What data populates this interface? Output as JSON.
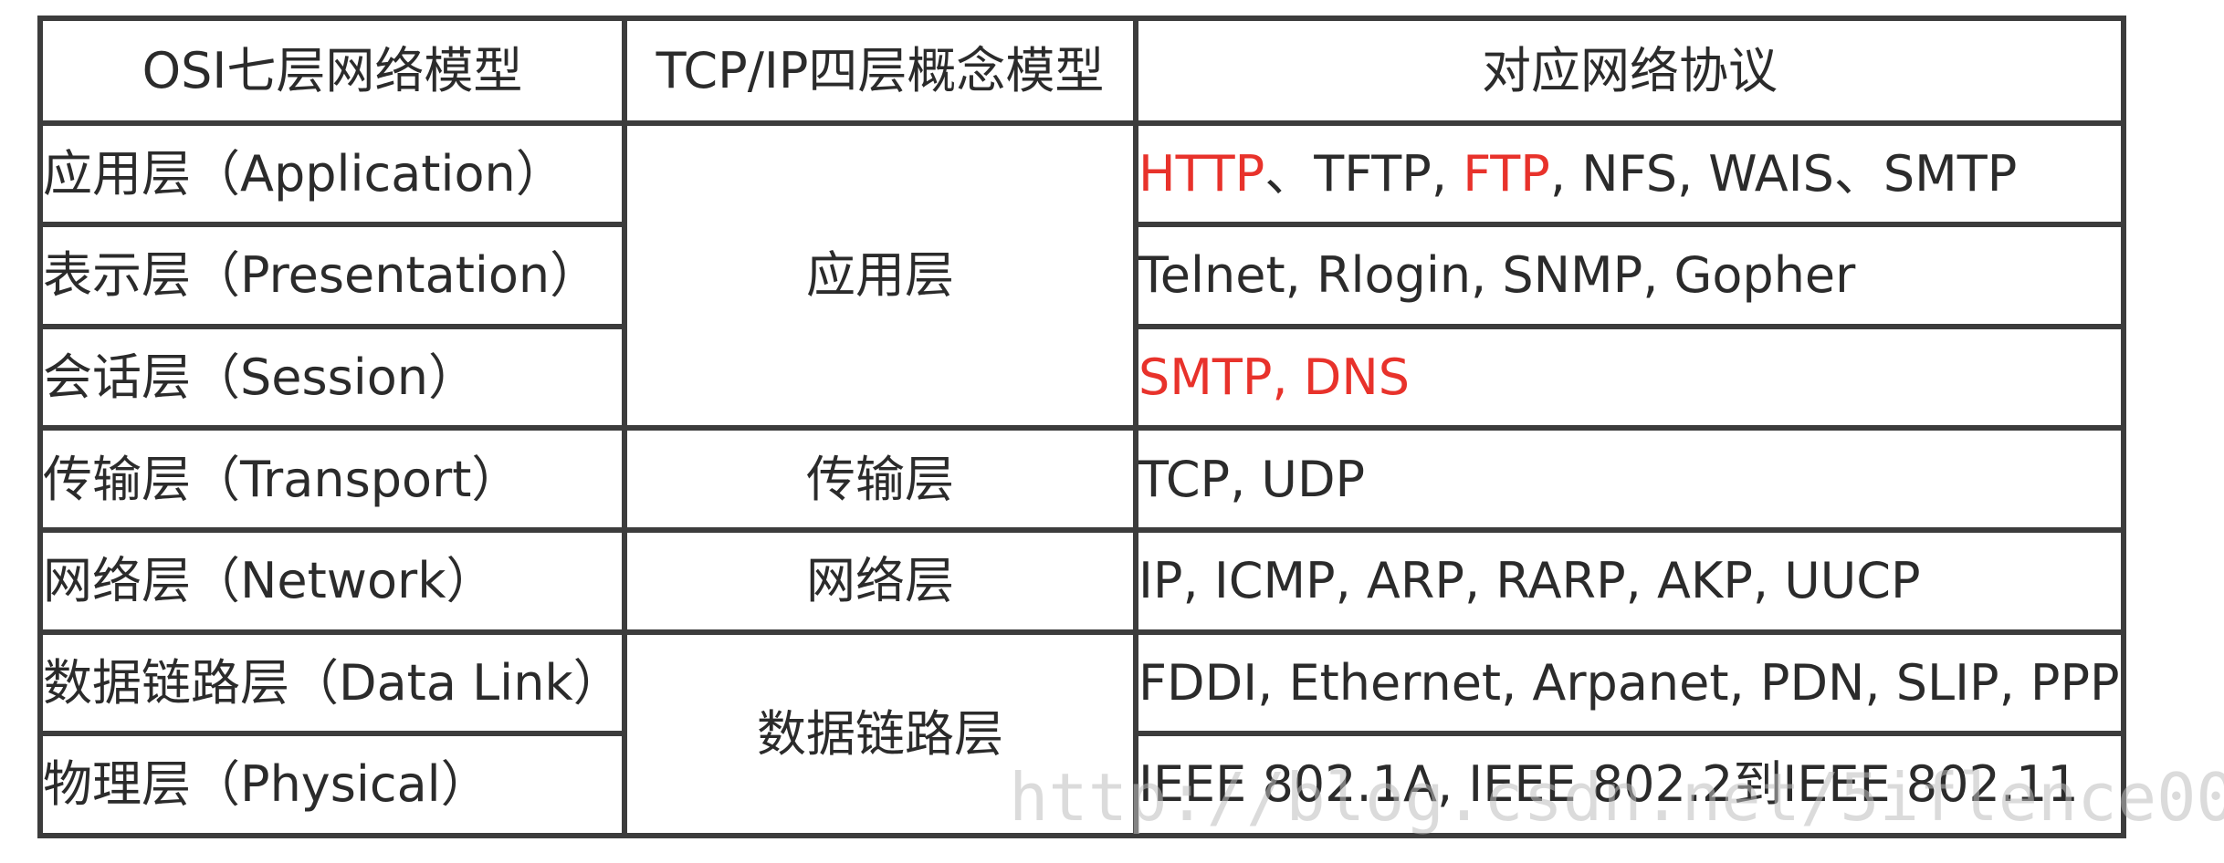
{
  "header": {
    "osi_model": "OSI七层网络模型",
    "tcpip_model": "TCP/IP四层概念模型",
    "protocols": "对应网络协议"
  },
  "rows": [
    {
      "osi": "应用层（Application）",
      "tcpip": "应用层",
      "protocols": [
        {
          "text": "HTTP",
          "red": true
        },
        {
          "text": "、TFTP, ",
          "red": false
        },
        {
          "text": "FTP",
          "red": true
        },
        {
          "text": ", NFS, WAIS、SMTP",
          "red": false
        }
      ]
    },
    {
      "osi": "表示层（Presentation）",
      "protocols": [
        {
          "text": "Telnet, Rlogin, SNMP, Gopher",
          "red": false
        }
      ]
    },
    {
      "osi": "会话层（Session）",
      "protocols": [
        {
          "text": "SMTP, DNS",
          "red": true
        }
      ]
    },
    {
      "osi": "传输层（Transport）",
      "tcpip": "传输层",
      "protocols": [
        {
          "text": "TCP, UDP",
          "red": false
        }
      ]
    },
    {
      "osi": "网络层（Network）",
      "tcpip": "网络层",
      "protocols": [
        {
          "text": "IP, ICMP, ARP, RARP, AKP, UUCP",
          "red": false
        }
      ]
    },
    {
      "osi": "数据链路层（Data Link）",
      "tcpip": "数据链路层",
      "protocols": [
        {
          "text": "FDDI, Ethernet, Arpanet, PDN, SLIP, PPP",
          "red": false
        }
      ]
    },
    {
      "osi": "物理层（Physical）",
      "protocols": [
        {
          "text": "IEEE 802.1A, IEEE 802.2到IEEE 802.11",
          "red": false
        }
      ]
    }
  ],
  "watermark": "http://blog.csdn.net/5iflence00",
  "colors": {
    "highlight": "#e8322b",
    "text": "#2b2b2b",
    "border": "#3c3c3c"
  }
}
